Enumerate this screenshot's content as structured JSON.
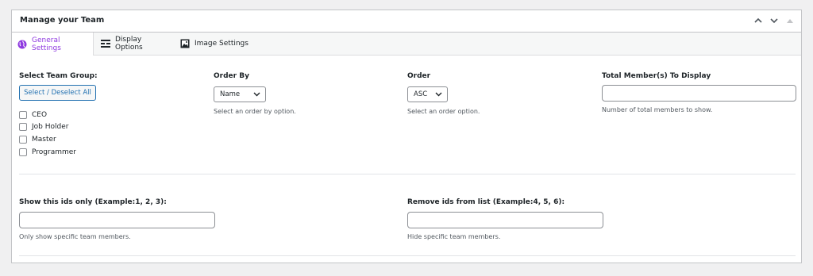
{
  "panel": {
    "title": "Manage your Team"
  },
  "tabs": [
    {
      "label": "General Settings",
      "icon": "globe-icon",
      "active": true,
      "color": "#8f3ae0"
    },
    {
      "label": "Display Options",
      "icon": "layout-icon",
      "active": false
    },
    {
      "label": "Image Settings",
      "icon": "image-icon",
      "active": false
    }
  ],
  "team_group": {
    "label": "Select Team Group:",
    "toggle_button": "Select / Deselect All",
    "options": [
      "CEO",
      "Job Holder",
      "Master",
      "Programmer"
    ]
  },
  "order_by": {
    "label": "Order By",
    "selected": "Name",
    "help": "Select an order by option."
  },
  "order": {
    "label": "Order",
    "selected": "ASC",
    "help": "Select an order option."
  },
  "total_members": {
    "label": "Total Member(s) To Display",
    "value": "",
    "help": "Number of total members to show."
  },
  "show_ids": {
    "label": "Show this ids only (Example:1, 2, 3):",
    "value": "",
    "help": "Only show specific team members."
  },
  "remove_ids": {
    "label": "Remove ids from list (Example:4, 5, 6):",
    "value": "",
    "help": "Hide specific team members."
  },
  "colors": {
    "accent": "#8f3ae0",
    "link": "#2271b1"
  }
}
